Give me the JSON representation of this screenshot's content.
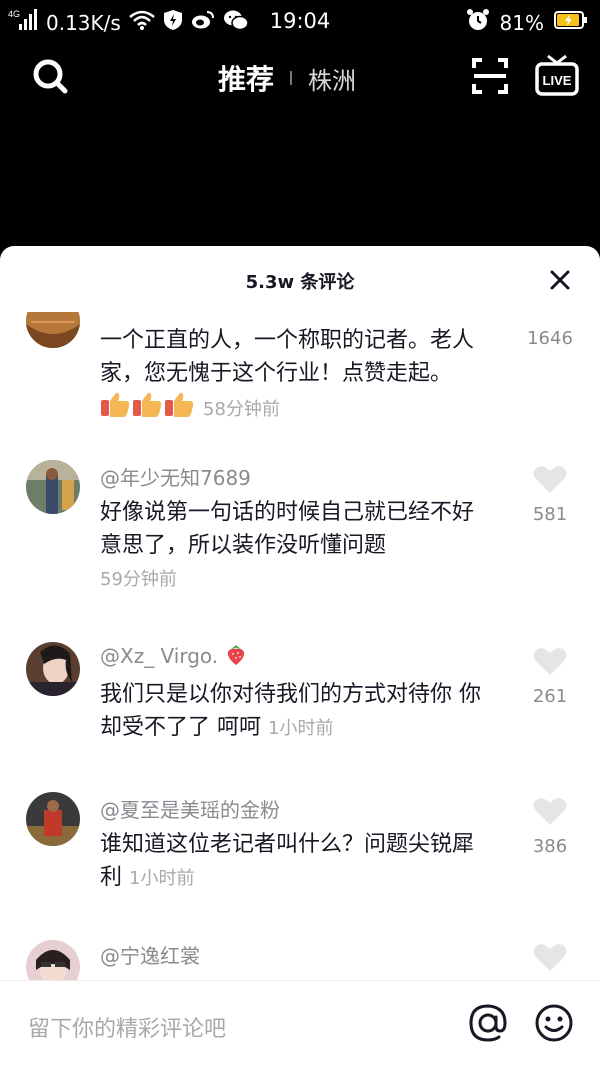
{
  "status_bar": {
    "network_label": "4G",
    "speed": "0.13K/s",
    "time": "19:04",
    "battery": "81%",
    "icons": [
      "signal-icon",
      "wifi-icon",
      "shield-icon",
      "weibo-icon",
      "wechat-icon",
      "alarm-icon",
      "battery-charging-icon"
    ]
  },
  "nav": {
    "tab_recommend": "推荐",
    "tab_city": "株洲",
    "icons": [
      "search-icon",
      "scan-icon",
      "live-icon"
    ],
    "live_text": "LIVE"
  },
  "sheet": {
    "title": "5.3w 条评论",
    "close_icon": "close-icon"
  },
  "comments": [
    {
      "user": "",
      "text": "一个正直的人，一个称职的记者。老人家，您无愧于这个行业！点赞走起。",
      "time": "58分钟前",
      "likes": "1646",
      "emoji": "thumbs-up-icon"
    },
    {
      "user": "@年少无知7689",
      "text": "好像说第一句话的时候自己就已经不好意思了，所以装作没听懂问题",
      "time": "59分钟前",
      "likes": "581"
    },
    {
      "user": "@Xz_ Virgo.",
      "user_emoji": "strawberry-icon",
      "text": "我们只是以你对待我们的方式对待你 你却受不了了 呵呵",
      "time": "1小时前",
      "likes": "261"
    },
    {
      "user": "@夏至是美瑶的金粉",
      "text": "谁知道这位老记者叫什么？问题尖锐犀利",
      "time": "1小时前",
      "likes": "386"
    },
    {
      "user": "@宁逸红裳",
      "text": "",
      "time": "",
      "likes": ""
    }
  ],
  "input": {
    "placeholder": "留下你的精彩评论吧",
    "at_icon": "at-icon",
    "emoji_icon": "smiley-icon"
  },
  "colors": {
    "background_top": "#000000",
    "sheet_bg": "#ffffff",
    "text_primary": "#161823",
    "text_secondary": "#8a8b91",
    "heart": "#e5e5e8"
  }
}
